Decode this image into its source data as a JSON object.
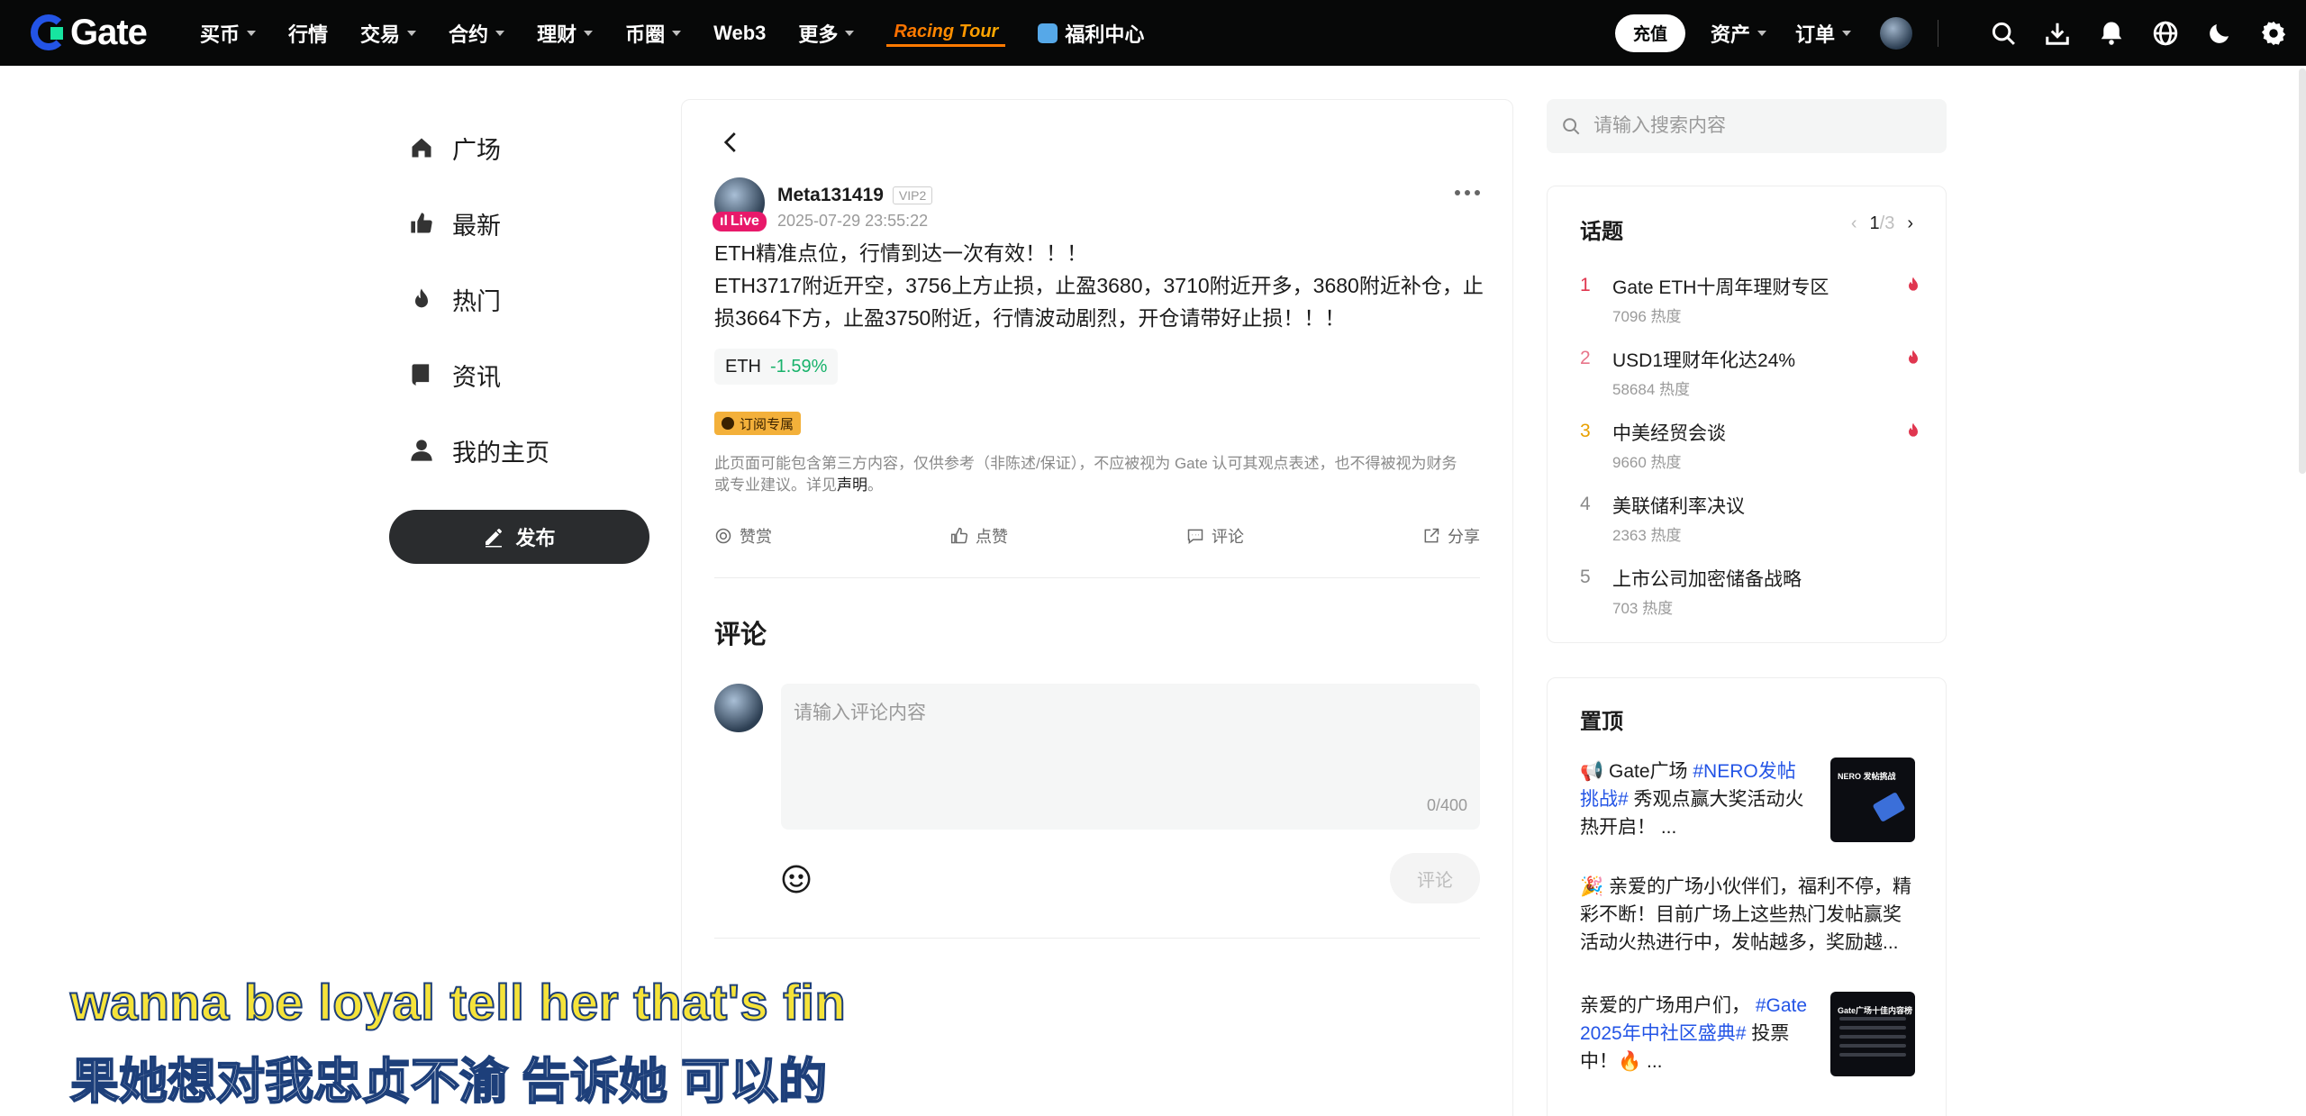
{
  "nav": {
    "logo": "Gate",
    "items": [
      "买币",
      "行情",
      "交易",
      "合约",
      "理财",
      "币圈",
      "Web3",
      "更多"
    ],
    "racing": "Racing Tour",
    "fuli": "福利中心",
    "deposit": "充值",
    "assets": "资产",
    "orders": "订单",
    "icons": [
      "search-icon",
      "download-icon",
      "bell-icon",
      "globe-icon",
      "moon-icon",
      "gear-icon"
    ]
  },
  "sidebar": {
    "items": [
      {
        "label": "广场",
        "icon": "home-icon"
      },
      {
        "label": "最新",
        "icon": "thumb-icon"
      },
      {
        "label": "热门",
        "icon": "fire-icon"
      },
      {
        "label": "资讯",
        "icon": "book-icon"
      },
      {
        "label": "我的主页",
        "icon": "user-icon"
      }
    ],
    "publish": "发布"
  },
  "post": {
    "author": "Meta131419",
    "vip": "VIP2",
    "live": "Live",
    "time": "2025-07-29 23:55:22",
    "line1": "ETH精准点位，行情到达一次有效！！！",
    "line2": "ETH3717附近开空，3756上方止损，止盈3680，3710附近开多，3680附近补仓，止损3664下方，止盈3750附近，行情波动剧烈，开仓请带好止损！！！",
    "tag_symbol": "ETH",
    "tag_change": "-1.59%",
    "subscribe_badge": "订阅专属",
    "disclaimer": "此页面可能包含第三方内容，仅供参考（非陈述/保证），不应被视为 Gate 认可其观点表述，也不得被视为财务或专业建议。详见",
    "disclaimer_link": "声明",
    "disclaimer_end": "。",
    "actions": {
      "reward": "赞赏",
      "like": "点赞",
      "comment": "评论",
      "share": "分享"
    }
  },
  "comments": {
    "title": "评论",
    "placeholder": "请输入评论内容",
    "count": "0/400",
    "send": "评论"
  },
  "search": {
    "placeholder": "请输入搜索内容"
  },
  "topics": {
    "title": "话题",
    "page": "1",
    "total": "/3",
    "items": [
      {
        "rank": "1",
        "title": "Gate ETH十周年理财专区",
        "heat": "7096 热度",
        "hot": true,
        "color": "#e0364f"
      },
      {
        "rank": "2",
        "title": "USD1理财年化达24%",
        "heat": "58684 热度",
        "hot": true,
        "color": "#e8758a"
      },
      {
        "rank": "3",
        "title": "中美经贸会谈",
        "heat": "9660 热度",
        "hot": true,
        "color": "#e8a000"
      },
      {
        "rank": "4",
        "title": "美联储利率决议",
        "heat": "2363 热度",
        "hot": false,
        "color": "#8a8a8a"
      },
      {
        "rank": "5",
        "title": "上市公司加密储备战略",
        "heat": "703 热度",
        "hot": false,
        "color": "#8a8a8a"
      }
    ]
  },
  "pinned": {
    "title": "置顶",
    "item1": {
      "prefix": "📢 Gate广场 ",
      "hash": "#NERO发帖挑战#",
      "rest": " 秀观点赢大奖活动火热开启！ ...",
      "thumb": "NERO 发帖挑战"
    },
    "item2": {
      "text": "🎉 亲爱的广场小伙伴们，福利不停，精彩不断！目前广场上这些热门发帖赢奖活动火热进行中，发帖越多，奖励越..."
    },
    "item3": {
      "prefix": "亲爱的广场用户们， ",
      "hash": "#Gate 2025年中社区盛典#",
      "rest": " 投票中！🔥 ...",
      "thumb": "Gate广场十佳内容榜"
    }
  },
  "subtitle": {
    "en": "wanna be loyal tell her that's fin",
    "zh": "果她想对我忠贞不渝 告诉她 可以的"
  }
}
